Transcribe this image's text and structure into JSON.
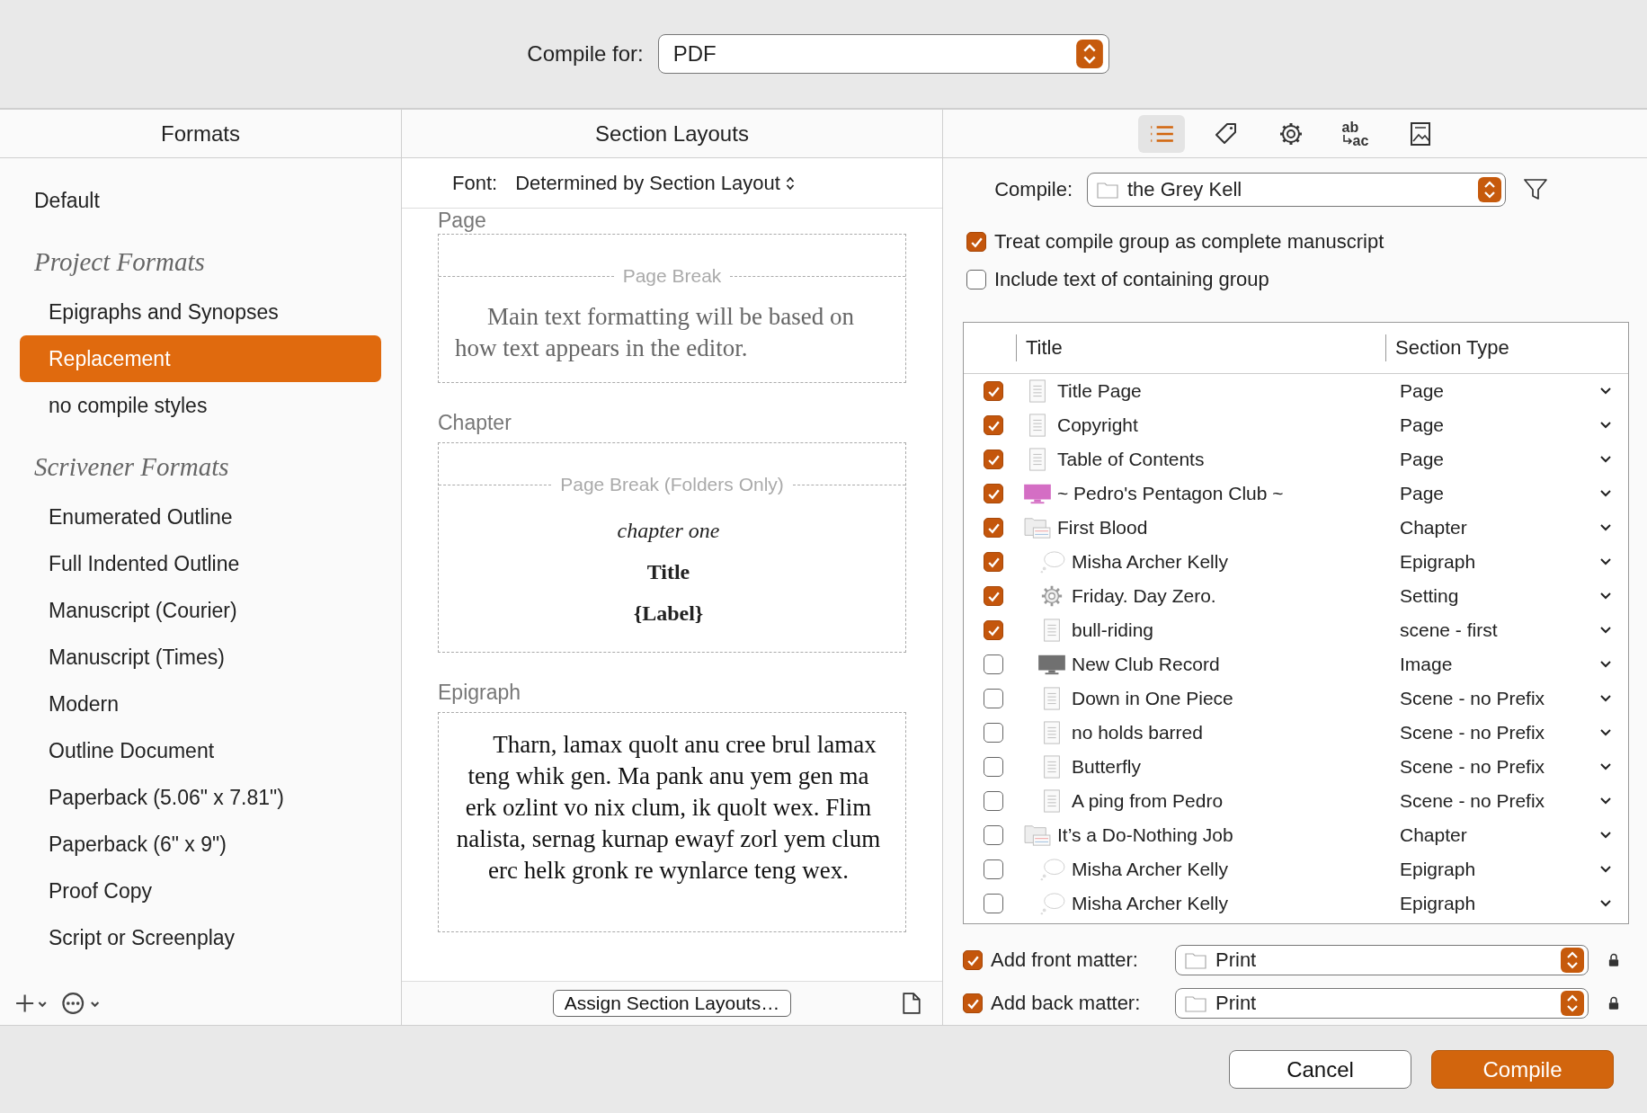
{
  "compile_for": {
    "label": "Compile for:",
    "value": "PDF"
  },
  "formats": {
    "title": "Formats",
    "items": [
      {
        "label": "Default",
        "selected": false
      },
      {
        "label": "Project Formats",
        "children": [
          {
            "label": "Epigraphs and Synopses",
            "selected": false
          },
          {
            "label": "Replacement",
            "selected": true
          },
          {
            "label": "no compile styles",
            "selected": false
          }
        ]
      },
      {
        "label": "Scrivener Formats",
        "children": [
          {
            "label": "Enumerated Outline",
            "selected": false
          },
          {
            "label": "Full Indented Outline",
            "selected": false
          },
          {
            "label": "Manuscript (Courier)",
            "selected": false
          },
          {
            "label": "Manuscript (Times)",
            "selected": false
          },
          {
            "label": "Modern",
            "selected": false
          },
          {
            "label": "Outline Document",
            "selected": false
          },
          {
            "label": "Paperback (5.06\" x 7.81\")",
            "selected": false
          },
          {
            "label": "Paperback (6\" x 9\")",
            "selected": false
          },
          {
            "label": "Proof Copy",
            "selected": false
          },
          {
            "label": "Script or Screenplay",
            "selected": false
          }
        ]
      }
    ]
  },
  "section_layouts": {
    "title": "Section Layouts",
    "font_label": "Font:",
    "font_value": "Determined by Section Layout",
    "sections": [
      {
        "label": "Page",
        "break": "Page Break",
        "elements": [
          {
            "kind": "note",
            "text": "Main text formatting will be based on how text appears in the editor."
          }
        ]
      },
      {
        "label": "Chapter",
        "break": "Page Break (Folders Only)",
        "elements": [
          {
            "kind": "italic",
            "text": "chapter one"
          },
          {
            "kind": "bold",
            "text": "Title"
          },
          {
            "kind": "bold",
            "text": "{Label}"
          }
        ]
      },
      {
        "label": "Epigraph",
        "elements": [
          {
            "kind": "paragraph",
            "text": "Tharn, lamax quolt anu cree brul lamax teng whik gen. Ma pank anu yem gen ma erk ozlint vo nix clum, ik quolt wex. Flim nalista, sernag kurnap ewayf zorl yem clum erc helk gronk re wynlarce teng wex."
          }
        ]
      }
    ],
    "assign_button": "Assign Section Layouts…"
  },
  "contents": {
    "tabs": [
      {
        "kind": "list",
        "selected": true
      },
      {
        "kind": "tag",
        "selected": false
      },
      {
        "kind": "gear",
        "selected": false
      },
      {
        "kind": "replace",
        "top": "ab",
        "bottom": "ac",
        "selected": false
      },
      {
        "kind": "image",
        "selected": false
      }
    ],
    "compile_label": "Compile:",
    "compile_value": "the Grey Kell",
    "options": [
      {
        "label": "Treat compile group as complete manuscript",
        "checked": true
      },
      {
        "label": "Include text of containing group",
        "checked": false
      }
    ],
    "table": {
      "columns": [
        "Title",
        "Section Type"
      ],
      "rows": [
        {
          "title": "Title Page",
          "kind": "text",
          "checked": true,
          "section_type": "Page"
        },
        {
          "title": "Copyright",
          "kind": "text",
          "checked": true,
          "section_type": "Page"
        },
        {
          "title": "Table of Contents",
          "kind": "text",
          "checked": true,
          "section_type": "Page"
        },
        {
          "title": "~ Pedro's Pentagon Club ~",
          "kind": "image",
          "color": "#d46ec4",
          "checked": true,
          "section_type": "Page"
        },
        {
          "title": "First Blood",
          "kind": "folder",
          "checked": true,
          "section_type": "Chapter",
          "children": [
            {
              "title": "Misha Archer Kelly",
              "kind": "bubble",
              "checked": true,
              "section_type": "Epigraph"
            },
            {
              "title": "Friday. Day Zero.",
              "kind": "gear",
              "checked": true,
              "section_type": "Setting"
            },
            {
              "title": "bull-riding",
              "kind": "text",
              "checked": true,
              "section_type": "scene - first"
            },
            {
              "title": "New Club Record",
              "kind": "image",
              "color": "#707070",
              "checked": false,
              "section_type": "Image"
            },
            {
              "title": "Down in One Piece",
              "kind": "text",
              "checked": false,
              "section_type": "Scene - no Prefix"
            },
            {
              "title": "no holds barred",
              "kind": "text",
              "checked": false,
              "section_type": "Scene - no Prefix"
            },
            {
              "title": "Butterfly",
              "kind": "text",
              "checked": false,
              "section_type": "Scene - no Prefix"
            },
            {
              "title": "A ping from Pedro",
              "kind": "text",
              "checked": false,
              "section_type": "Scene - no Prefix"
            }
          ]
        },
        {
          "title": "It’s a Do-Nothing Job",
          "kind": "folder",
          "checked": false,
          "section_type": "Chapter",
          "children": [
            {
              "title": "Misha Archer Kelly",
              "kind": "bubble",
              "checked": false,
              "section_type": "Epigraph"
            },
            {
              "title": "Misha Archer Kelly",
              "kind": "bubble",
              "checked": false,
              "section_type": "Epigraph"
            }
          ]
        }
      ]
    },
    "matter": [
      {
        "label": "Add front matter:",
        "checked": true,
        "value": "Print"
      },
      {
        "label": "Add back matter:",
        "checked": true,
        "value": "Print"
      }
    ]
  },
  "buttons": [
    {
      "label": "Cancel",
      "kind": "secondary"
    },
    {
      "label": "Compile",
      "kind": "primary"
    }
  ]
}
